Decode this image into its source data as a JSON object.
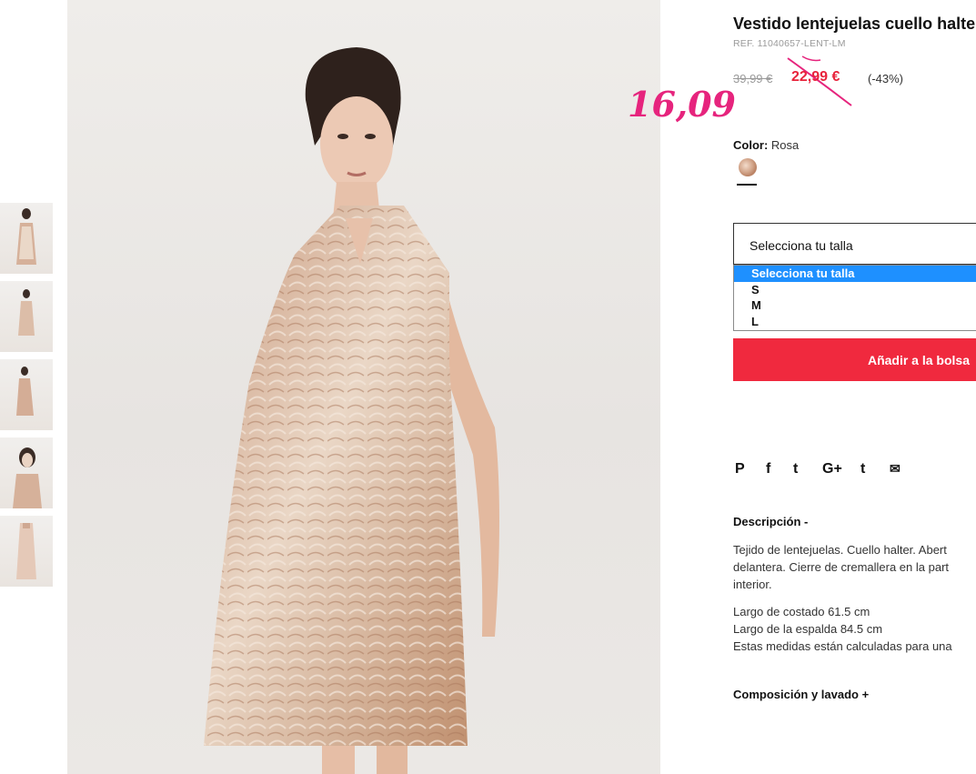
{
  "product": {
    "title": "Vestido lentejuelas cuello halter",
    "ref": "REF. 11040657-LENT-LM",
    "price_old": "39,99 €",
    "price_new": "22,99 €",
    "discount": "(-43%)",
    "annotated_price": "16,09",
    "color_label": "Color:",
    "color_value": "Rosa"
  },
  "size_select": {
    "placeholder": "Selecciona tu talla",
    "options": [
      "Selecciona tu talla",
      "S",
      "M",
      "L"
    ]
  },
  "add_to_bag": "Añadir a la bolsa",
  "social": {
    "pinterest": "P",
    "facebook": "f",
    "twitter": "t",
    "google": "G+",
    "tumblr": "t",
    "email": "✉"
  },
  "description": {
    "heading": "Descripción -",
    "line1": "Tejido de lentejuelas. Cuello halter. Abert",
    "line2": "delantera. Cierre de cremallera en la part",
    "line3": "interior.",
    "line4": "Largo de costado 61.5 cm",
    "line5": "Largo de la espalda 84.5 cm",
    "line6": "Estas medidas están calculadas para una"
  },
  "composition_heading": "Composición y lavado +",
  "colors": {
    "accent_red": "#f0293e",
    "price_red": "#e8243c",
    "annotation_pink": "#e6247d",
    "select_highlight": "#1e90ff"
  }
}
